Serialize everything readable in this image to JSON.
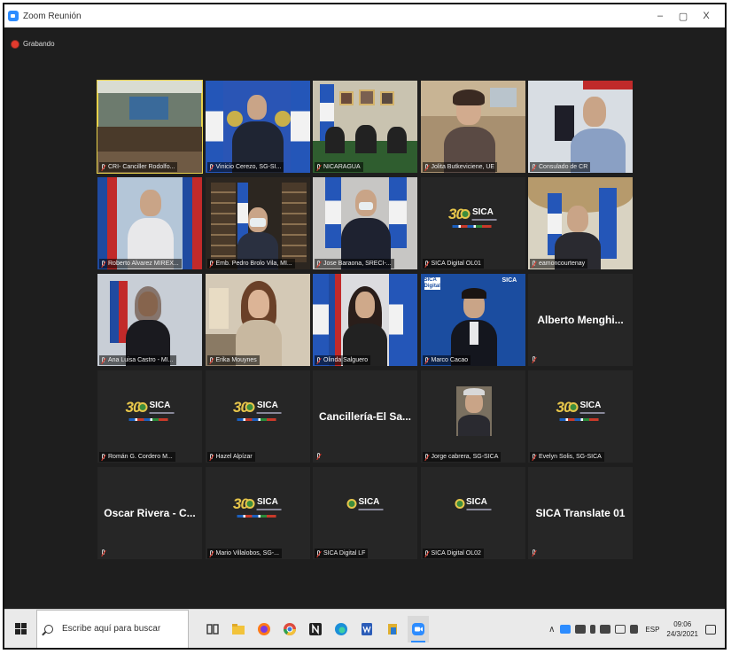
{
  "window": {
    "title": "Zoom Reunión",
    "controls": [
      "–",
      "▢",
      "X"
    ]
  },
  "recording": {
    "label": "Grabando"
  },
  "tiles": [
    {
      "name": "CRI- Canciller Rodolfo..."
    },
    {
      "name": "Vinicio Cerezo, SG-SI..."
    },
    {
      "name": "NICARAGUA"
    },
    {
      "name": "Jolita Butkeviciene, UE"
    },
    {
      "name": "Consulado de CR"
    },
    {
      "name": "Roberto Alvarez MIREX..."
    },
    {
      "name": "Emb. Pedro Brolo Vila, MI..."
    },
    {
      "name": "Jose Baraona, SRECI-..."
    },
    {
      "name": "SICA Digital OL01"
    },
    {
      "name": "eamoncourtenay"
    },
    {
      "name": "Ana Luisa Castro - MI..."
    },
    {
      "name": "Erika Mouynes"
    },
    {
      "name": "Olinda Salguero"
    },
    {
      "name": "Marco Cacao"
    },
    {
      "name": "",
      "big": "Alberto Menghi..."
    },
    {
      "name": "Román G. Cordero M..."
    },
    {
      "name": "Hazel Alpízar"
    },
    {
      "name": "",
      "big": "Cancillería-El Sa..."
    },
    {
      "name": "Jorge cabrera, SG-SICA"
    },
    {
      "name": "Evelyn Solis, SG-SICA"
    },
    {
      "name": "",
      "big": "Oscar Rivera - C..."
    },
    {
      "name": "Mario Villalobos, SG-..."
    },
    {
      "name": "SICA Digital LF"
    },
    {
      "name": "SICA Digital OL02"
    },
    {
      "name": "",
      "big": "SICA Translate 01"
    }
  ],
  "logo": {
    "num": "30",
    "text": "SICA"
  },
  "tile_labels": {
    "sica_digital": "SICA",
    "digital": "Digital"
  },
  "taskbar": {
    "search_placeholder": "Escribe aquí para buscar",
    "lang": "ESP",
    "time": "09:06",
    "date": "24/3/2021"
  }
}
